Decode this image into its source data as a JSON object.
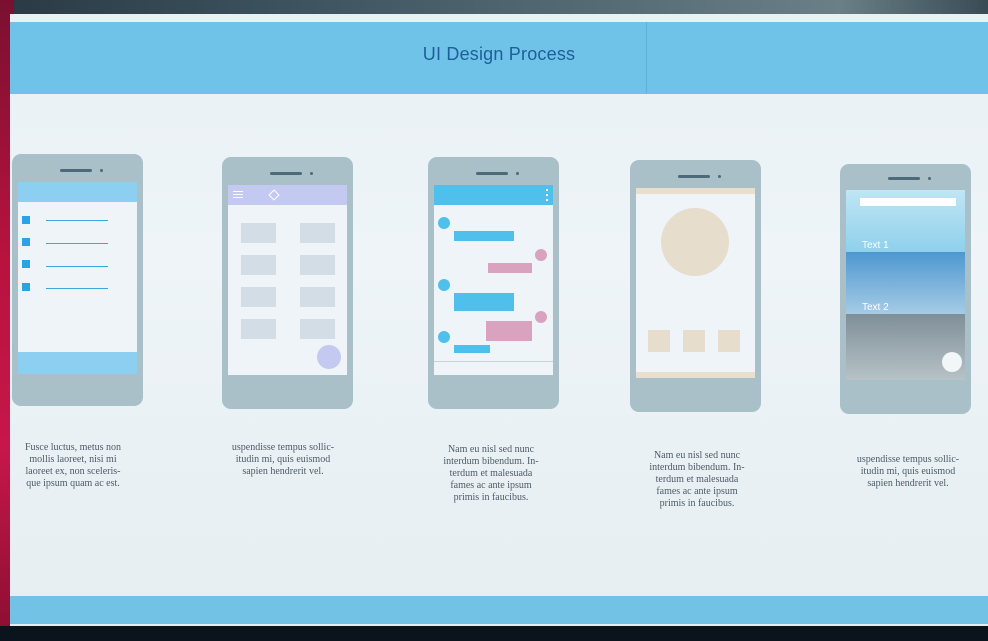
{
  "header": {
    "title": "UI Design Process"
  },
  "phones": [
    {
      "caption": "Fusce luctus, metus non\nmollis laoreet, nisi mi\nlaoreet ex, non sceleris-\nque ipsum quam ac est."
    },
    {
      "caption": "uspendisse tempus sollic-\nitudin mi, quis euismod\nsapien hendrerit vel."
    },
    {
      "caption": "Nam eu nisl sed nunc\ninterdum bibendum. In-\nterdum et malesuada\nfames ac ante ipsum\nprimis in faucibus."
    },
    {
      "caption": "Nam eu nisl sed nunc\ninterdum bibendum. In-\nterdum et malesuada\nfames ac ante ipsum\nprimis in faucibus."
    },
    {
      "caption": "uspendisse tempus sollic-\nitudin mi, quis euismod\nsapien hendrerit vel.",
      "text1": "Text 1",
      "text2": "Text 2"
    }
  ],
  "colors": {
    "header_bar": "#6fc2e8",
    "title_text": "#1f5e9a",
    "accent_blue": "#4fc0ec",
    "accent_pink": "#d9a2bf",
    "accent_lavender": "#c4c9f1",
    "phone_body": "#a9c0c9",
    "screen_bg": "#eef4f7"
  },
  "icons": [
    "hamburger-menu-icon",
    "diamond-icon",
    "overflow-menu-icon",
    "fab-icon"
  ]
}
